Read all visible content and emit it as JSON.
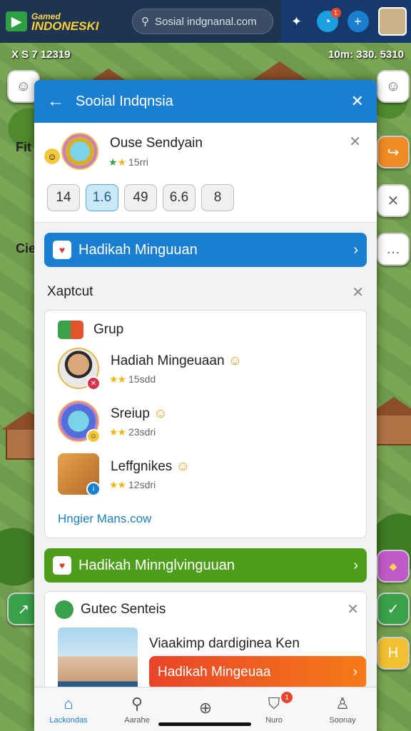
{
  "topbar": {
    "logo_small": "Gamed",
    "logo_big": "INDONESKI",
    "search_placeholder": "Sosial indgnanal.com",
    "notif_count": "1"
  },
  "game": {
    "hud_left": "X S 7 12319",
    "hud_right": "10m: 330. 5310",
    "side_label_1": "Fit",
    "side_label_2": "Cie"
  },
  "panel": {
    "title": "Sooial Indqnsia",
    "profile": {
      "name": "Ouse Sendyain",
      "meta": "15rri",
      "chips": [
        "14",
        "1.6",
        "49",
        "6.6",
        "8"
      ]
    },
    "banner_top": "Hadikah Minguuan",
    "section_title": "Xaptcut",
    "group": {
      "title": "Grup",
      "rows": [
        {
          "name": "Hadiah Mingeuaan",
          "meta": "15sdd"
        },
        {
          "name": "Sreiup",
          "meta": "23sdri"
        },
        {
          "name": "Leffgnikes",
          "meta": "12sdri"
        }
      ],
      "link": "Hngier Mans.cow"
    },
    "banner_bottom": "Hadikah Minnglvinguuan",
    "gutec": {
      "title": "Gutec Senteis",
      "text": "Viaakimp dardiginea Ken",
      "button": "Hadikah Mingeuaa"
    }
  },
  "bottom_nav": {
    "items": [
      {
        "label": "Lackondas",
        "icon": "home-icon"
      },
      {
        "label": "Aarahe",
        "icon": "search-icon"
      },
      {
        "label": "",
        "icon": "add-icon"
      },
      {
        "label": "Nuro",
        "icon": "notification-icon",
        "badge": "1"
      },
      {
        "label": "Soonay",
        "icon": "profile-icon"
      }
    ]
  },
  "colors": {
    "accent_blue": "#1a7fd0",
    "accent_green": "#4e9e1c",
    "accent_orange": "#f57a18"
  }
}
